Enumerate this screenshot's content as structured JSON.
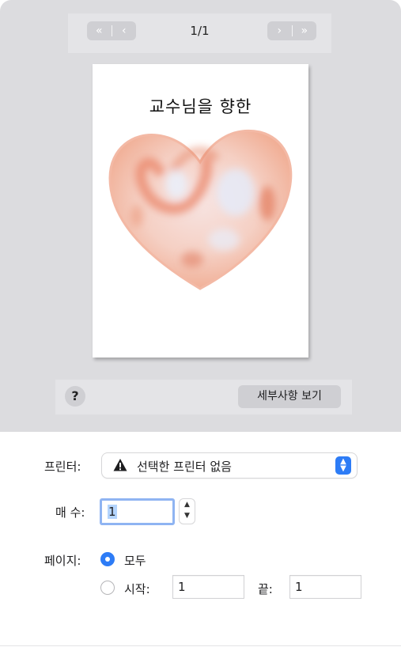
{
  "preview": {
    "page_indicator": "1/1",
    "first_page_glyph": "«",
    "prev_page_glyph": "‹",
    "next_page_glyph": "›",
    "last_page_glyph": "»",
    "document_title": "교수님을 향한",
    "image_icon": "heart-image"
  },
  "toolbar": {
    "help_label": "?",
    "details_label": "세부사항 보기"
  },
  "form": {
    "printer_label": "프린터:",
    "printer_value": "선택한 프린터 없음",
    "printer_warning_icon": "warning-icon",
    "copies_label": "매 수:",
    "copies_value": "1",
    "pages_label": "페이지:",
    "all_label": "모두",
    "start_label": "시작:",
    "start_value": "1",
    "end_label": "끝:",
    "end_value": "1"
  },
  "colors": {
    "accent": "#2d7cf6",
    "preview_background": "#dcdcdf",
    "heart": "#ee9b7c"
  }
}
